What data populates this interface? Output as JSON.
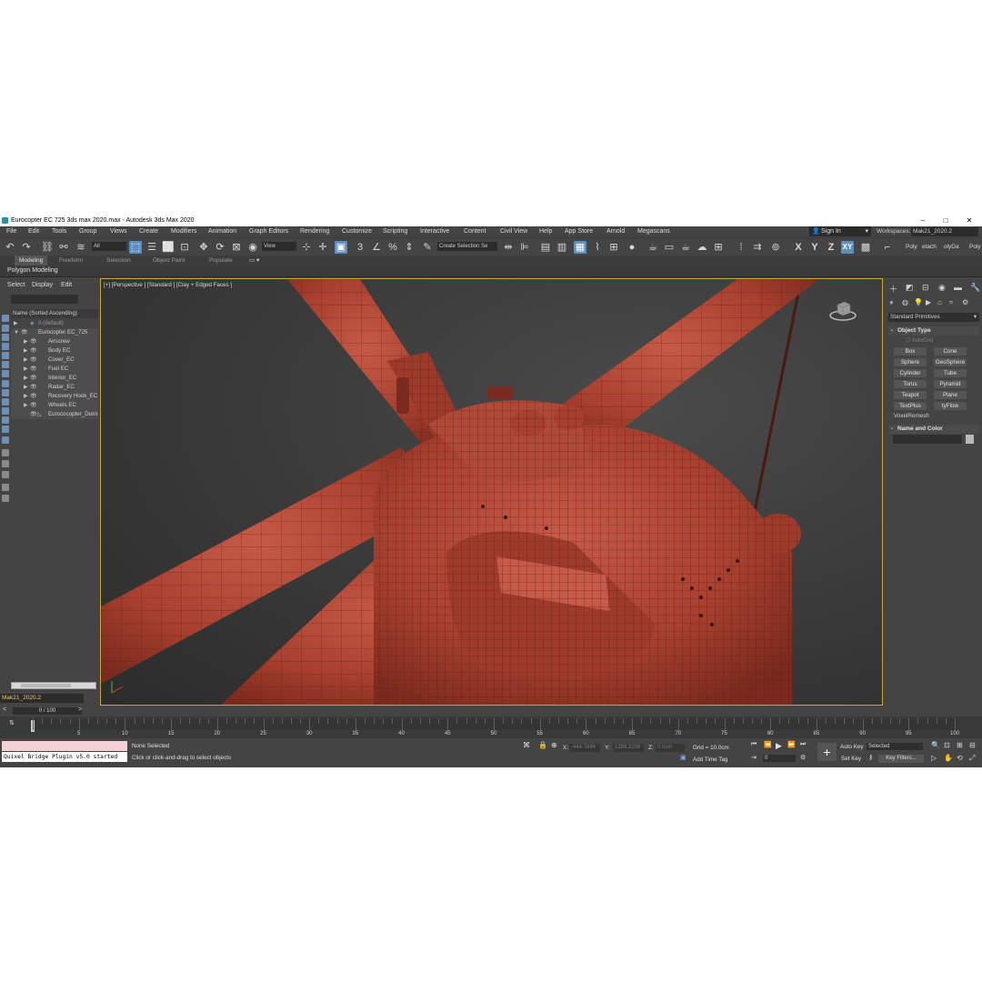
{
  "window": {
    "title": "Eurocopter EC 725 3ds max 2020.max - Autodesk 3ds Max 2020",
    "minimize": "–",
    "maximize": "□",
    "close": "✕"
  },
  "menu": [
    "File",
    "Edit",
    "Tools",
    "Group",
    "Views",
    "Create",
    "Modifiers",
    "Animation",
    "Graph Editors",
    "Rendering",
    "Customize",
    "Scripting",
    "Interactive",
    "Content",
    "Civil View",
    "Help",
    "App Store",
    "Arnold",
    "Megascans"
  ],
  "account": {
    "sign_in": "Sign In",
    "workspaces_label": "Workspaces:",
    "workspace": "Mak21_2020.2"
  },
  "toolbar": {
    "selection_filter": "All",
    "ref_coord": "View",
    "selection_set": "Create Selection Se",
    "axes": [
      "X",
      "Y",
      "Z",
      "XY"
    ],
    "right_tools": [
      "Poly",
      "etach",
      "olyDa",
      "Poly"
    ]
  },
  "ribbon": {
    "tabs": [
      "Modeling",
      "Freeform",
      "Selection",
      "Object Paint",
      "Populate"
    ],
    "active_tab": "Modeling",
    "sub": "Polygon Modeling"
  },
  "explorer": {
    "tabs": [
      "Select",
      "Display",
      "Edit"
    ],
    "header": "Name (Sorted Ascending)",
    "items": [
      {
        "label": "0 (default)",
        "level": 0
      },
      {
        "label": "Eurocopter EC_725",
        "level": 0
      },
      {
        "label": "Airscrew",
        "level": 1
      },
      {
        "label": "Body EC",
        "level": 1
      },
      {
        "label": "Cover_EC",
        "level": 1
      },
      {
        "label": "Fuel EC",
        "level": 1
      },
      {
        "label": "Interior_EC",
        "level": 1
      },
      {
        "label": "Radar_EC",
        "level": 1
      },
      {
        "label": "Recovery Hook_EC",
        "level": 1
      },
      {
        "label": "Wheels EC",
        "level": 1
      },
      {
        "label": "Eurococopter_Dumi",
        "level": 1
      }
    ],
    "layer": "Mak21_2020.2"
  },
  "viewport": {
    "label": "[+] [Perspective ] [Standard ] [Clay + Edged Faces ]"
  },
  "command_panel": {
    "category": "Standard Primitives",
    "object_type_header": "Object Type",
    "autogrid": "AutoGrid",
    "buttons": [
      "Box",
      "Cone",
      "Sphere",
      "GeoSphere",
      "Cylinder",
      "Tube",
      "Torus",
      "Pyramid",
      "Teapot",
      "Plane",
      "TextPlus",
      "tyFlow"
    ],
    "extra": "VoxelRemesh",
    "name_color_header": "Name and Color"
  },
  "timeline": {
    "slider": "0 / 100",
    "prev": "<",
    "next": ">",
    "ticks": [
      "0",
      "5",
      "10",
      "15",
      "20",
      "25",
      "30",
      "35",
      "40",
      "45",
      "50",
      "55",
      "60",
      "65",
      "70",
      "75",
      "80",
      "85",
      "90",
      "95",
      "100"
    ]
  },
  "status": {
    "maxscript_output": "Quixel Bridge Plugin v5.0 started",
    "selection": "None Selected",
    "prompt": "Click or click-and-drag to select objects",
    "x_label": "X:",
    "x_value": "-444.7894",
    "y_label": "Y:",
    "y_value": "1288.3256",
    "z_label": "Z:",
    "z_value": "0.0cm",
    "grid": "Grid = 10.0cm",
    "add_time_tag": "Add Time Tag",
    "auto_key": "Auto Key",
    "set_key": "Set Key",
    "key_mode": "Selected",
    "key_filters": "Key Filters...",
    "frame": "0"
  },
  "colors": {
    "body_red": "#b8483a",
    "viewport_border": "#c9a43a",
    "ui_gray": "#444444"
  }
}
